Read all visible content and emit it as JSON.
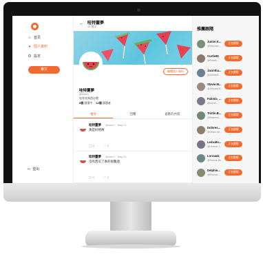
{
  "nav": {
    "items": [
      {
        "label": "首頁",
        "icon": "home-icon"
      },
      {
        "label": "個人資料",
        "icon": "user-icon"
      },
      {
        "label": "設定",
        "icon": "gear-icon"
      }
    ],
    "post_label": "推文",
    "logout_label": "登出"
  },
  "profile": {
    "header_name": "哇特靈夢",
    "header_count": "12 推文",
    "edit_label": "編輯個人資料",
    "name": "哇特靈夢",
    "handle": "@user1",
    "bio": "哇哇哇夠西瓜哦",
    "following_count": "0個",
    "following_label": "跟隨中",
    "followers_count": "12個",
    "followers_label": "跟隨者"
  },
  "tabs": [
    "推文",
    "回覆",
    "喜歡的內容"
  ],
  "tweets": [
    {
      "name": "哇特靈夢",
      "meta": "@user1 · May 21",
      "text": "真是好熱啊",
      "replies": "0",
      "likes": "0"
    },
    {
      "name": "哇特靈夢",
      "meta": "@user1 · May 21",
      "text": "沒有西瓜了真的很難過",
      "replies": "0",
      "likes": "0"
    }
  ],
  "recommend": {
    "title": "推薦跟隨",
    "follow_label": "正在跟隨",
    "users": [
      {
        "name": "Junior.K...",
        "handle": "@Stephan..."
      },
      {
        "name": "Curtis90",
        "handle": "@Estrell..."
      },
      {
        "name": "Jacintha...",
        "handle": "@Alexand..."
      },
      {
        "name": "Stevie.M...",
        "handle": "@Jessica.M..."
      },
      {
        "name": "Fabiola_...",
        "handle": "@Kai.W..."
      },
      {
        "name": "Tristin.B...",
        "handle": "@Makenzi..."
      },
      {
        "name": "Dolores...",
        "handle": "@Grace.Mi..."
      },
      {
        "name": "Leda.Mo...",
        "handle": "@Lennon.J..."
      },
      {
        "name": "Lorraa41",
        "handle": "@Rennie.Be..."
      },
      {
        "name": "Delphin...",
        "handle": "@Ernesto..."
      }
    ]
  },
  "colors": {
    "accent": "#f26a2e",
    "banner": "#5ec5df"
  }
}
